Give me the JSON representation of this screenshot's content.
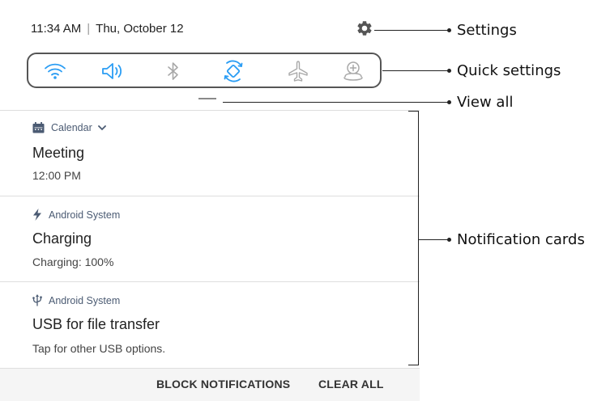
{
  "status_bar": {
    "time": "11:34 AM",
    "separator": "|",
    "date": "Thu, October 12"
  },
  "quick_settings": [
    {
      "name": "wifi-icon",
      "active": true
    },
    {
      "name": "sound-icon",
      "active": true
    },
    {
      "name": "bluetooth-icon",
      "active": false
    },
    {
      "name": "auto-rotate-icon",
      "active": true
    },
    {
      "name": "airplane-mode-icon",
      "active": false
    },
    {
      "name": "location-icon",
      "active": false
    }
  ],
  "colors": {
    "active": "#2a9df4",
    "inactive": "#a8a8a8",
    "accent_text": "#4b5b73"
  },
  "notifications": [
    {
      "app": "Calendar",
      "app_icon": "calendar-icon",
      "expand_icon": "chevron-down-icon",
      "title": "Meeting",
      "text": "12:00 PM"
    },
    {
      "app": "Android System",
      "app_icon": "charging-bolt-icon",
      "title": "Charging",
      "text": "Charging: 100%"
    },
    {
      "app": "Android System",
      "app_icon": "usb-icon",
      "title": "USB for file transfer",
      "text": "Tap for other USB options."
    }
  ],
  "actions": {
    "block": "BLOCK NOTIFICATIONS",
    "clear": "CLEAR ALL"
  },
  "callouts": {
    "settings": "Settings",
    "quick_settings": "Quick settings",
    "view_all": "View all",
    "notification_cards": "Notification cards"
  }
}
